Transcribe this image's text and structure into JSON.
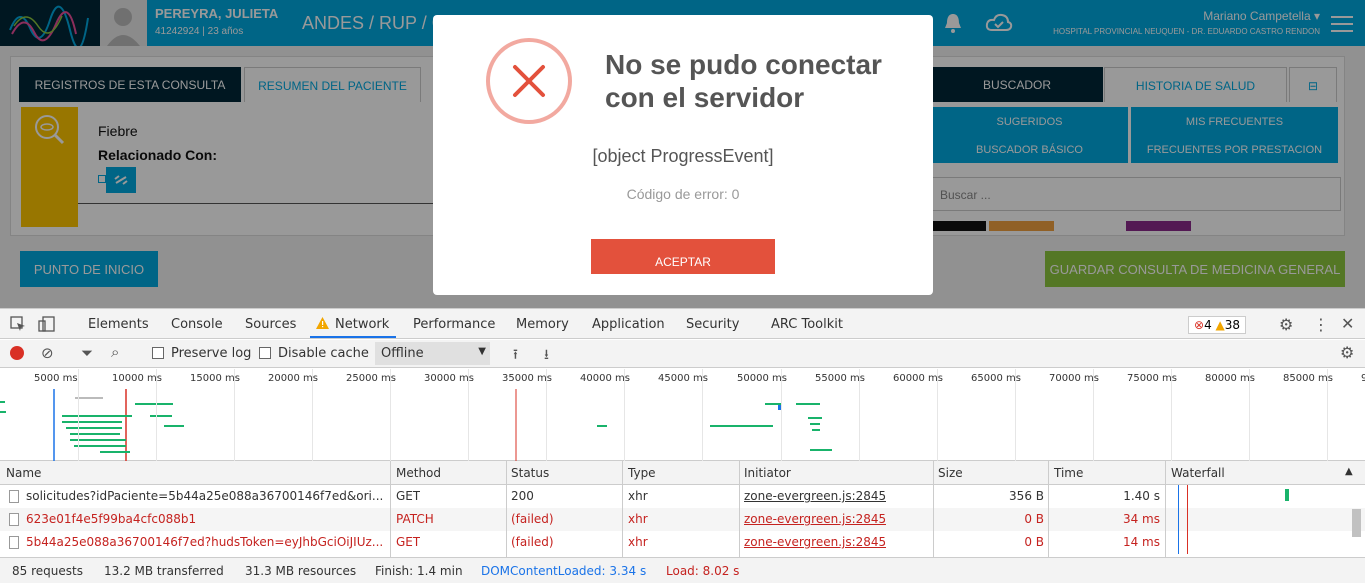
{
  "header": {
    "patient_name": "PEREYRA, JULIETA",
    "patient_meta": "41242924 | 23 años",
    "breadcrumb": "ANDES / RUP / C",
    "user_name": "Mariano Campetella",
    "hospital": "HOSPITAL PROVINCIAL NEUQUEN - DR. EDUARDO CASTRO RENDON"
  },
  "tabs_left": [
    "REGISTROS DE ESTA CONSULTA",
    "RESUMEN DEL PACIENTE"
  ],
  "tabs_right": [
    "BUSCADOR",
    "HISTORIA DE SALUD"
  ],
  "registro": {
    "title": "Fiebre",
    "related": "Relacionado Con:"
  },
  "search": {
    "buttons": [
      "SUGERIDOS",
      "MIS FRECUENTES",
      "BUSCADOR BÁSICO",
      "FRECUENTES POR PRESTACION"
    ],
    "placeholder": "Buscar ..."
  },
  "bottom": {
    "start_label": "PUNTO DE INICIO",
    "save_label": "GUARDAR CONSULTA DE MEDICINA GENERAL"
  },
  "modal": {
    "title": "No se pudo conectar con el servidor",
    "message": "[object ProgressEvent]",
    "code": "Código de error: 0",
    "accept": "ACEPTAR"
  },
  "devtools": {
    "tabs": [
      "Elements",
      "Console",
      "Sources",
      "Network",
      "Performance",
      "Memory",
      "Application",
      "Security",
      "ARC Toolkit"
    ],
    "errors": "4",
    "warnings": "38",
    "preserve_log": "Preserve log",
    "disable_cache": "Disable cache",
    "throttle": "Offline",
    "ticks": [
      "5000 ms",
      "10000 ms",
      "15000 ms",
      "20000 ms",
      "25000 ms",
      "30000 ms",
      "35000 ms",
      "40000 ms",
      "45000 ms",
      "50000 ms",
      "55000 ms",
      "60000 ms",
      "65000 ms",
      "70000 ms",
      "75000 ms",
      "80000 ms",
      "85000 ms",
      "9"
    ],
    "columns": [
      "Name",
      "Method",
      "Status",
      "Type",
      "Initiator",
      "Size",
      "Time",
      "Waterfall"
    ],
    "rows": [
      {
        "name": "solicitudes?idPaciente=5b44a25e088a36700146f7ed&ori...",
        "method": "GET",
        "status": "200",
        "type": "xhr",
        "initiator": "zone-evergreen.js:2845",
        "size": "356 B",
        "time": "1.40 s",
        "failed": false
      },
      {
        "name": "623e01f4e5f99ba4cfc088b1",
        "method": "PATCH",
        "status": "(failed)",
        "type": "xhr",
        "initiator": "zone-evergreen.js:2845",
        "size": "0 B",
        "time": "34 ms",
        "failed": true
      },
      {
        "name": "5b44a25e088a36700146f7ed?hudsToken=eyJhbGciOiJIUz...",
        "method": "GET",
        "status": "(failed)",
        "type": "xhr",
        "initiator": "zone-evergreen.js:2845",
        "size": "0 B",
        "time": "14 ms",
        "failed": true
      }
    ],
    "status": {
      "requests": "85 requests",
      "transferred": "13.2 MB transferred",
      "resources": "31.3 MB resources",
      "finish": "Finish: 1.4 min",
      "dom": "DOMContentLoaded: 3.34 s",
      "load": "Load: 8.02 s"
    }
  }
}
